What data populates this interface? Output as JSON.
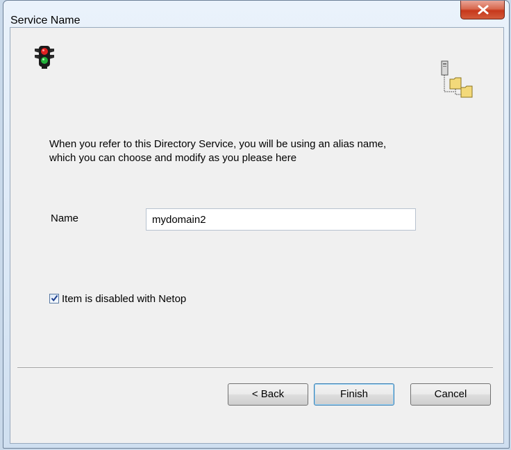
{
  "window": {
    "title": "Service Name",
    "close_icon": "close-x-icon"
  },
  "icons": {
    "header_left": "traffic-light-icon",
    "header_right": "directory-tree-icon"
  },
  "description": {
    "line1": "When you refer to this Directory Service, you will be using an alias name,",
    "line2": "which you can choose and modify as you please here"
  },
  "form": {
    "name_label": "Name",
    "name_value": "mydomain2",
    "disabled_checkbox_label": "Item is disabled with Netop",
    "disabled_checked": true
  },
  "buttons": {
    "back": "< Back",
    "finish": "Finish",
    "cancel": "Cancel"
  },
  "colors": {
    "close_button": "#c7371b",
    "default_button_border": "#3c7fb1"
  }
}
